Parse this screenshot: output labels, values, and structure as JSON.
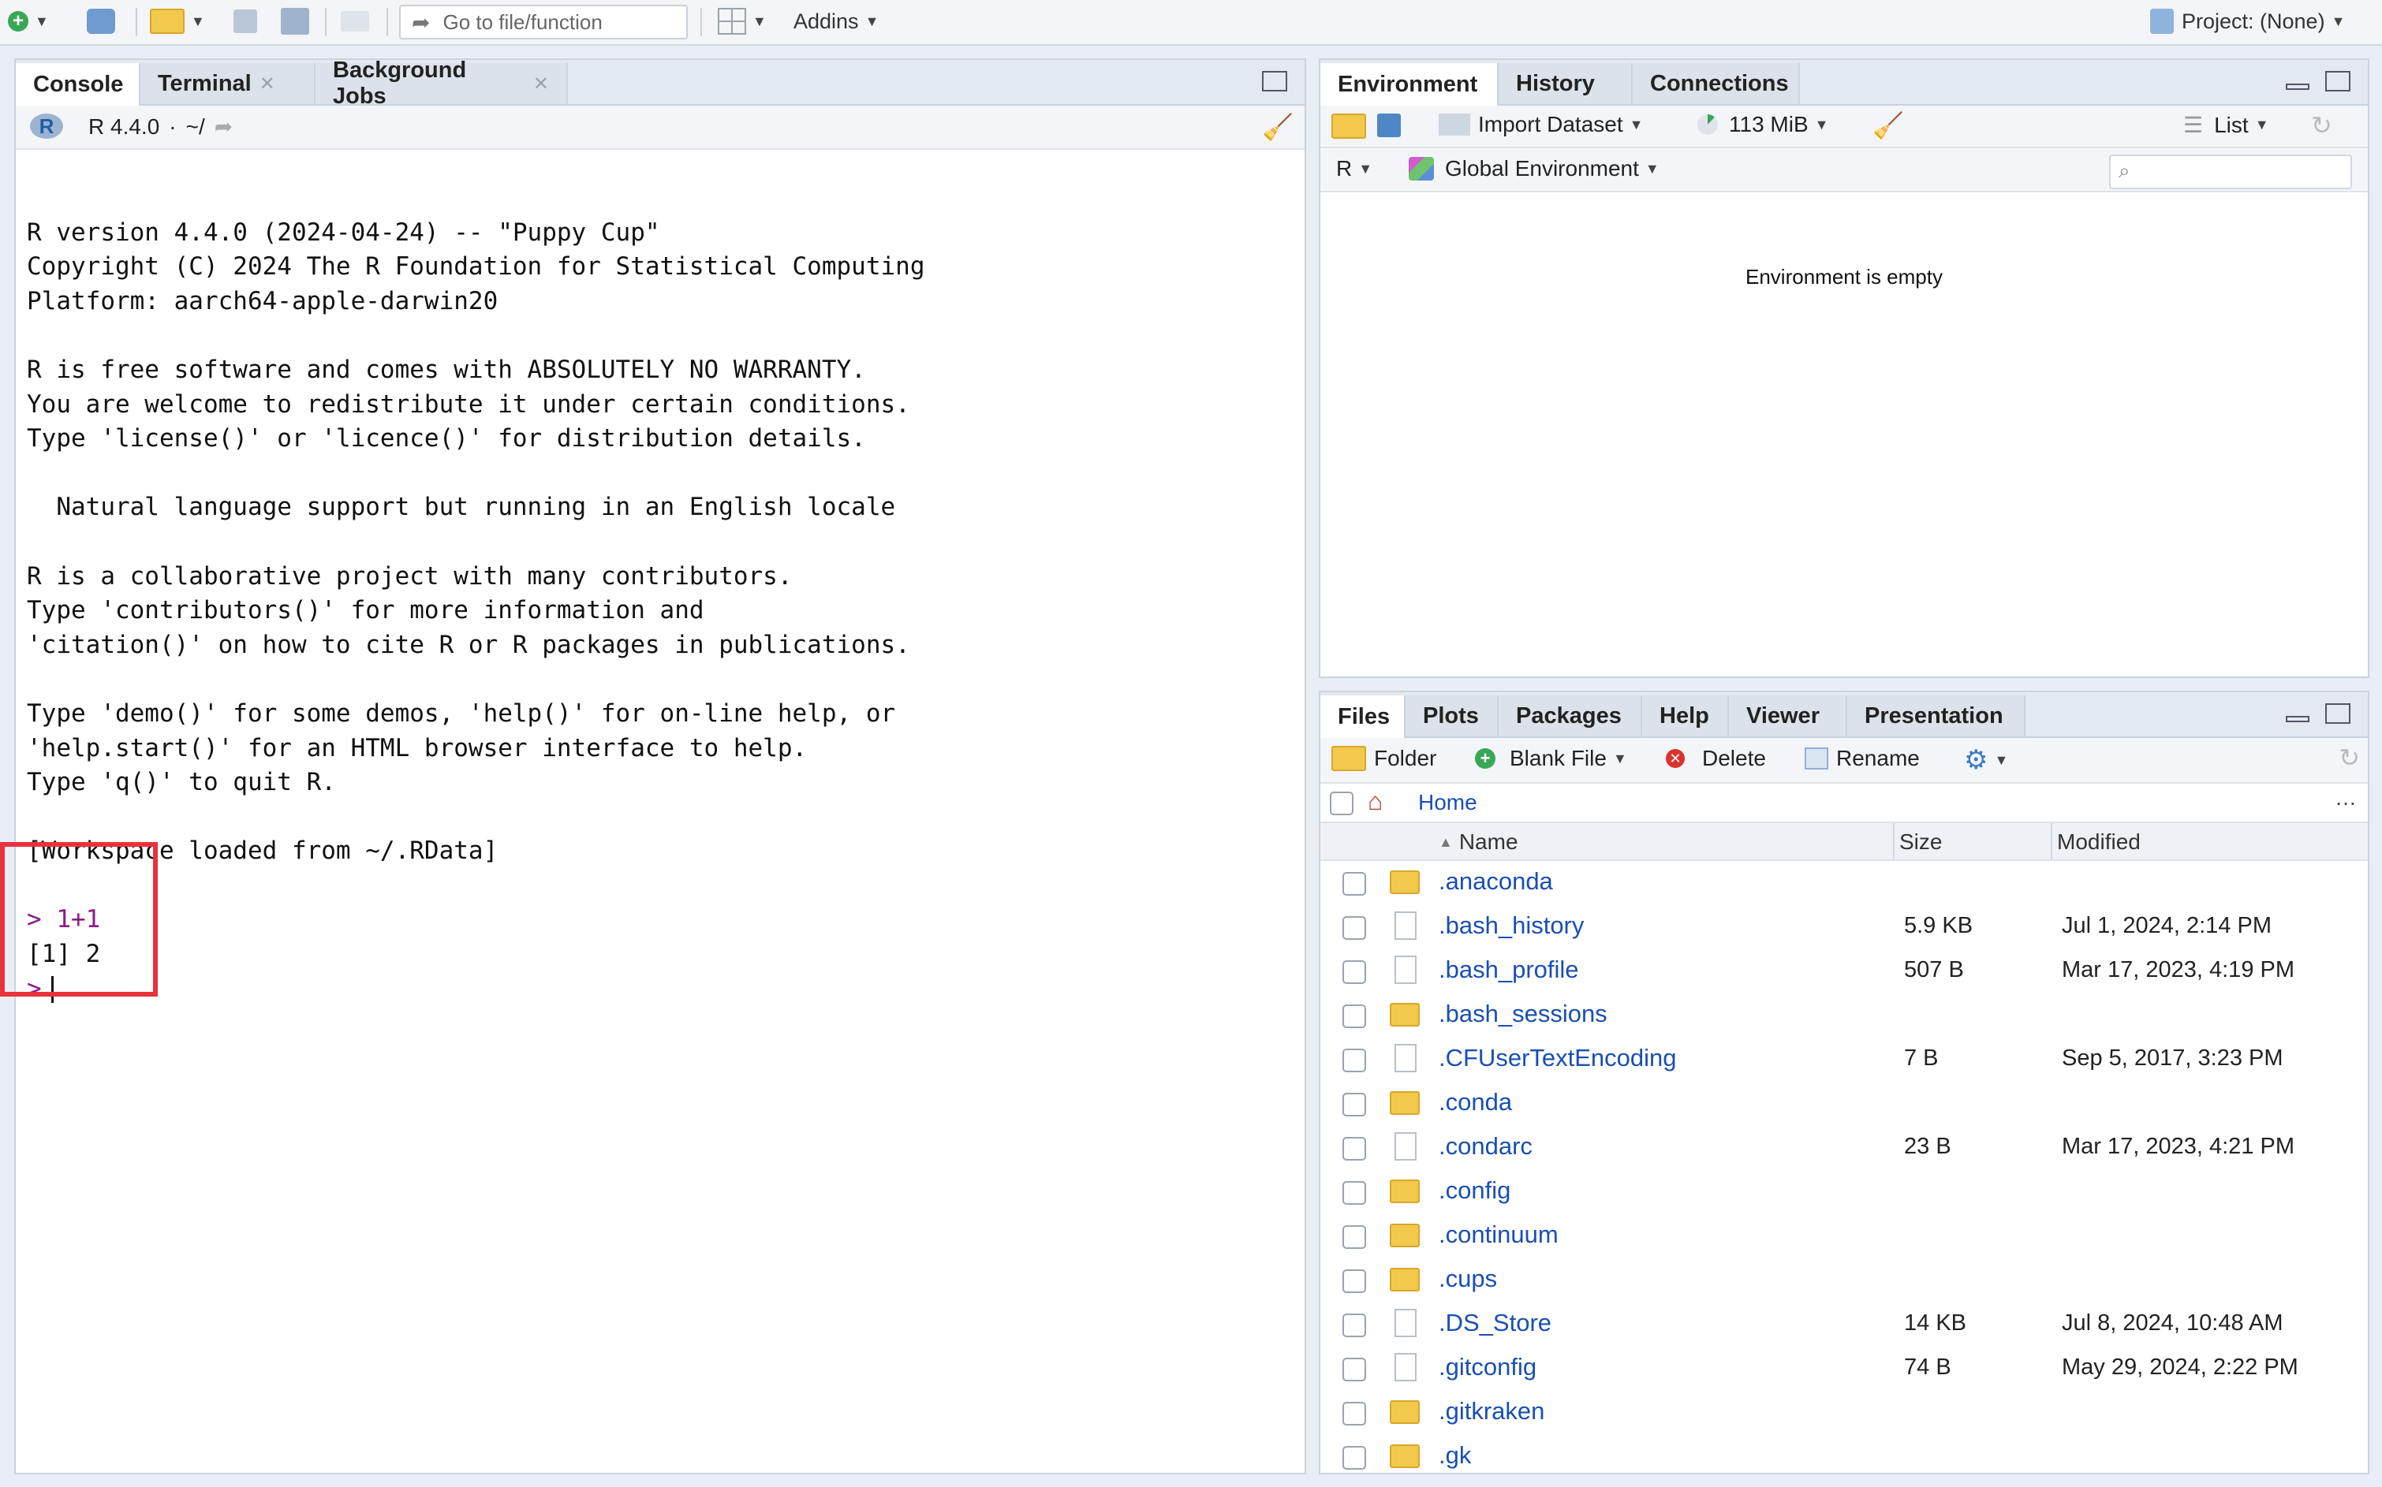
{
  "toolbar": {
    "goto_placeholder": "Go to file/function",
    "addins_label": "Addins",
    "project_label": "Project: (None)"
  },
  "console_pane": {
    "tabs": [
      "Console",
      "Terminal",
      "Background Jobs"
    ],
    "r_version_label": "R 4.4.0",
    "working_dir": "~/",
    "lines": [
      "",
      "R version 4.4.0 (2024-04-24) -- \"Puppy Cup\"",
      "Copyright (C) 2024 The R Foundation for Statistical Computing",
      "Platform: aarch64-apple-darwin20",
      "",
      "R is free software and comes with ABSOLUTELY NO WARRANTY.",
      "You are welcome to redistribute it under certain conditions.",
      "Type 'license()' or 'licence()' for distribution details.",
      "",
      "  Natural language support but running in an English locale",
      "",
      "R is a collaborative project with many contributors.",
      "Type 'contributors()' for more information and",
      "'citation()' on how to cite R or R packages in publications.",
      "",
      "Type 'demo()' for some demos, 'help()' for on-line help, or",
      "'help.start()' for an HTML browser interface to help.",
      "Type 'q()' to quit R.",
      "",
      "[Workspace loaded from ~/.RData]",
      ""
    ],
    "command": "> 1+1",
    "result": "[1] 2",
    "prompt": ">"
  },
  "env_pane": {
    "tabs": [
      "Environment",
      "History",
      "Connections"
    ],
    "import_label": "Import Dataset",
    "memory_label": "113 MiB",
    "view_label": "List",
    "language_label": "R",
    "scope_label": "Global Environment",
    "empty_message": "Environment is empty"
  },
  "files_pane": {
    "tabs": [
      "Files",
      "Plots",
      "Packages",
      "Help",
      "Viewer",
      "Presentation"
    ],
    "folder_label": "Folder",
    "blank_file_label": "Blank File",
    "delete_label": "Delete",
    "rename_label": "Rename",
    "breadcrumb": "Home",
    "columns": {
      "name": "Name",
      "size": "Size",
      "modified": "Modified"
    },
    "rows": [
      {
        "name": ".anaconda",
        "type": "folder",
        "size": "",
        "modified": ""
      },
      {
        "name": ".bash_history",
        "type": "file",
        "size": "5.9 KB",
        "modified": "Jul 1, 2024, 2:14 PM"
      },
      {
        "name": ".bash_profile",
        "type": "file",
        "size": "507 B",
        "modified": "Mar 17, 2023, 4:19 PM"
      },
      {
        "name": ".bash_sessions",
        "type": "folder",
        "size": "",
        "modified": ""
      },
      {
        "name": ".CFUserTextEncoding",
        "type": "file",
        "size": "7 B",
        "modified": "Sep 5, 2017, 3:23 PM"
      },
      {
        "name": ".conda",
        "type": "folder",
        "size": "",
        "modified": ""
      },
      {
        "name": ".condarc",
        "type": "file",
        "size": "23 B",
        "modified": "Mar 17, 2023, 4:21 PM"
      },
      {
        "name": ".config",
        "type": "folder",
        "size": "",
        "modified": ""
      },
      {
        "name": ".continuum",
        "type": "folder",
        "size": "",
        "modified": ""
      },
      {
        "name": ".cups",
        "type": "folder",
        "size": "",
        "modified": ""
      },
      {
        "name": ".DS_Store",
        "type": "file",
        "size": "14 KB",
        "modified": "Jul 8, 2024, 10:48 AM"
      },
      {
        "name": ".gitconfig",
        "type": "file",
        "size": "74 B",
        "modified": "May 29, 2024, 2:22 PM"
      },
      {
        "name": ".gitkraken",
        "type": "folder",
        "size": "",
        "modified": ""
      },
      {
        "name": ".gk",
        "type": "folder",
        "size": "",
        "modified": ""
      }
    ]
  },
  "colors": {
    "highlight_box": "#e8323c",
    "link": "#1a4fb3",
    "command": "#8a1c8a"
  }
}
